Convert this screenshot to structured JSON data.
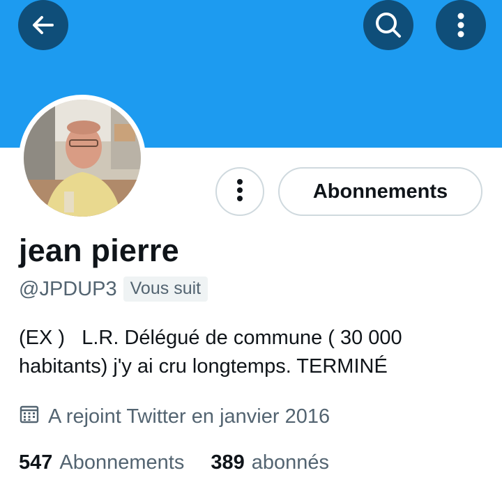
{
  "header": {
    "back_icon": "arrow-left-icon",
    "search_icon": "search-icon",
    "more_icon": "more-vertical-icon",
    "banner_color": "#1d9bf0",
    "button_color": "#0f4e79"
  },
  "profile": {
    "name": "jean pierre",
    "handle": "@JPDUP3",
    "follows_you_badge": "Vous suit",
    "following_button_label": "Abonnements",
    "bio_lines": [
      "(EX )   L.R. Délégué de commune ( 30 000",
      "habitants) j'y ai cru longtemps. TERMINÉ"
    ],
    "joined_icon": "calendar-icon",
    "joined_text": "A rejoint Twitter en janvier 2016",
    "stats": {
      "following_count": "547",
      "following_label": "Abonnements",
      "followers_count": "389",
      "followers_label": "abonnés"
    }
  }
}
